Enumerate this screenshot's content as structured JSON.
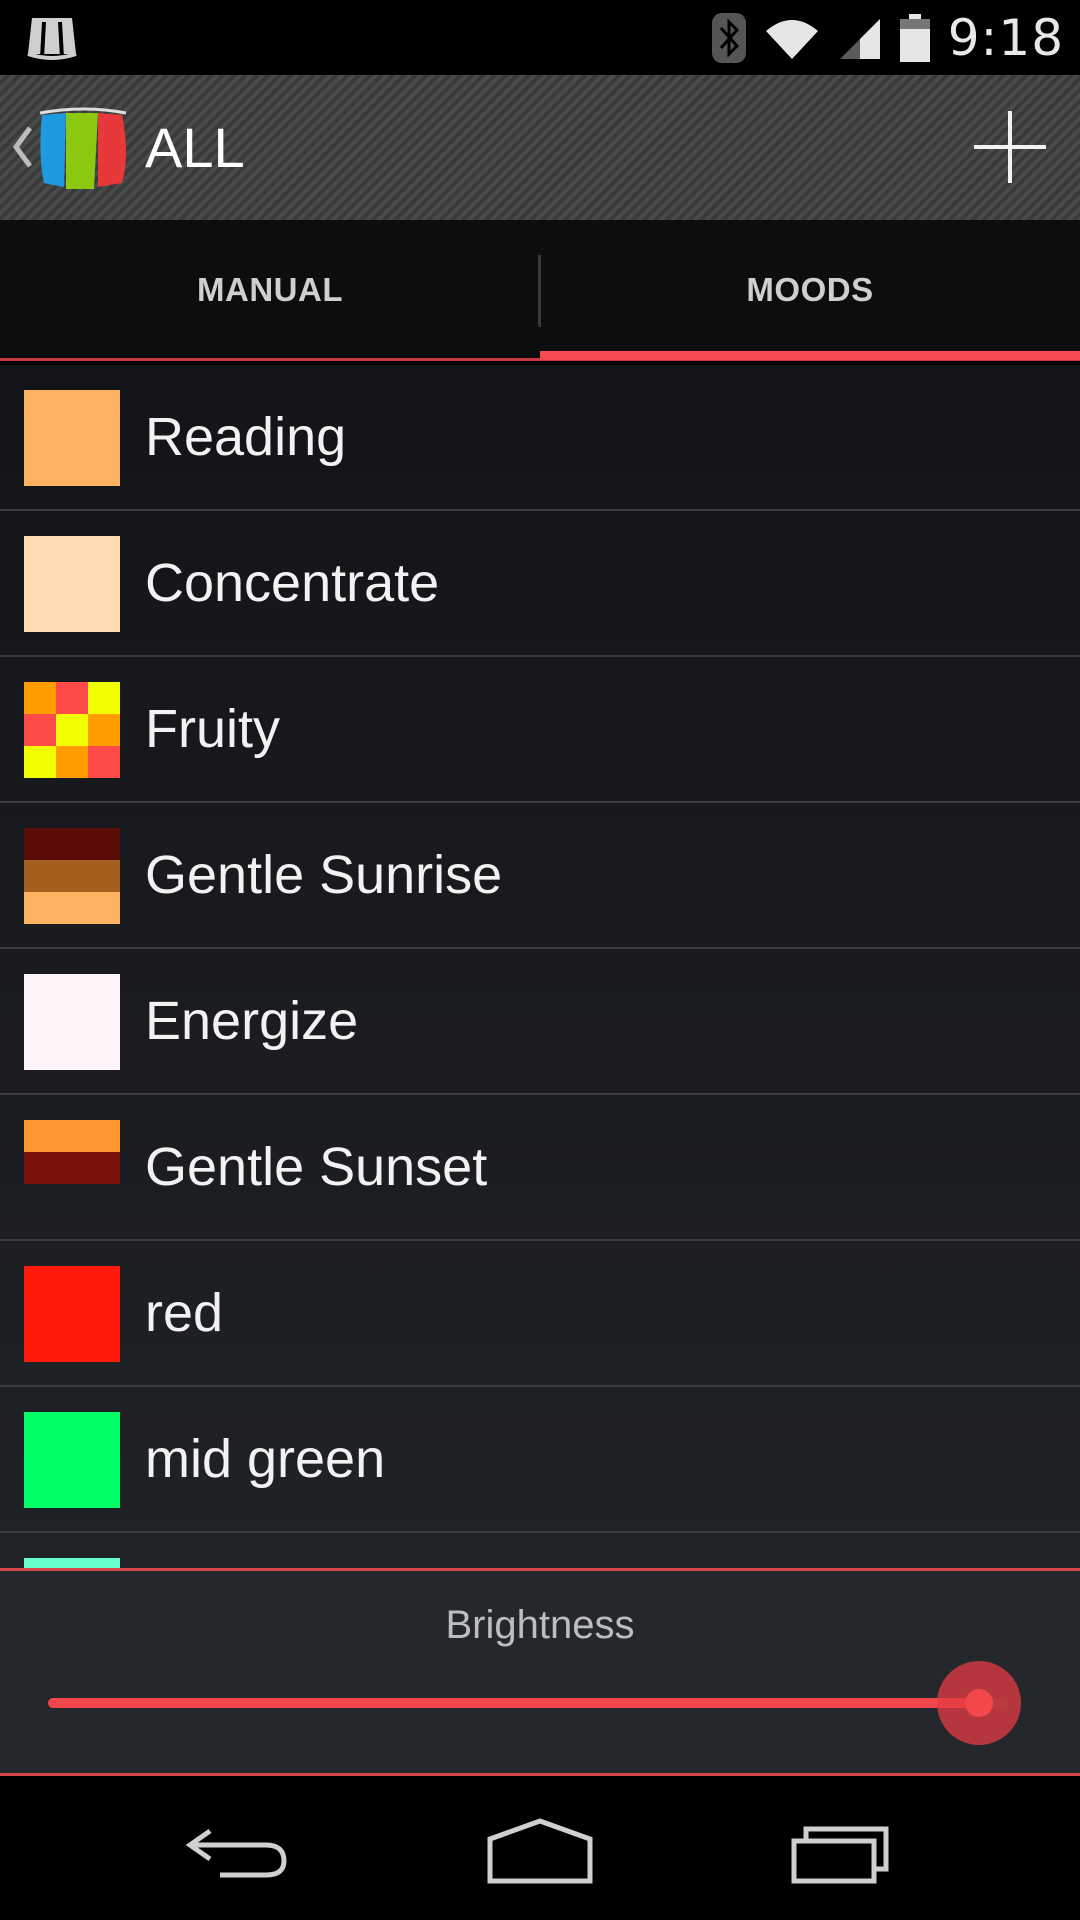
{
  "status_bar": {
    "time": "9:18",
    "icons": [
      "notification-lamp-icon",
      "bluetooth-icon",
      "wifi-icon",
      "signal-icon",
      "battery-icon"
    ]
  },
  "action_bar": {
    "title": "ALL",
    "icons": [
      "back-chevron-icon",
      "app-logo-icon",
      "add-icon"
    ]
  },
  "tabs": [
    {
      "label": "MANUAL",
      "selected": false
    },
    {
      "label": "MOODS",
      "selected": true
    }
  ],
  "accent_color": "#f34b4f",
  "moods": [
    {
      "name": "Reading",
      "colors": [
        "#ffb361"
      ]
    },
    {
      "name": "Concentrate",
      "colors": [
        "#ffdab3"
      ]
    },
    {
      "name": "Fruity",
      "colors": [
        "#ff9d00",
        "#ff4a4a",
        "#f2ff00",
        "#ff4a4a",
        "#f2ff00",
        "#ff9d00",
        "#f2ff00",
        "#ff9d00",
        "#ff4a4a"
      ]
    },
    {
      "name": "Gentle Sunrise",
      "colors": [
        "#5a0b06",
        "#a5601f",
        "#ffb361"
      ]
    },
    {
      "name": "Energize",
      "colors": [
        "#fff4fa"
      ]
    },
    {
      "name": "Gentle Sunset",
      "colors": [
        "#ff9730",
        "#7a120b"
      ]
    },
    {
      "name": "red",
      "colors": [
        "#ff1a0a"
      ]
    },
    {
      "name": "mid green",
      "colors": [
        "#00ff66"
      ]
    },
    {
      "name": "",
      "colors": [
        "#66ffcc"
      ]
    }
  ],
  "brightness": {
    "label": "Brightness",
    "value_fraction": 0.97
  },
  "nav_bar": {
    "icons": [
      "back-icon",
      "home-icon",
      "recents-icon"
    ]
  }
}
